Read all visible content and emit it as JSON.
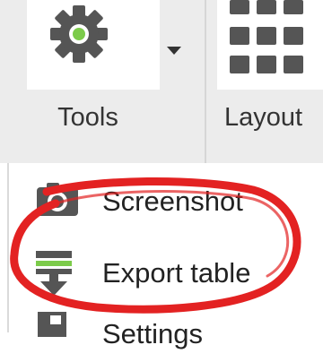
{
  "ribbon": {
    "tools": {
      "label": "Tools",
      "icon": "gear-icon",
      "accent": "#7ccb4a"
    },
    "layout": {
      "label": "Layout",
      "icon": "grid-icon"
    }
  },
  "menu": {
    "items": [
      {
        "label": "Screenshot",
        "icon": "camera-icon"
      },
      {
        "label": "Export table",
        "icon": "export-table-icon",
        "accent": "#7ccb4a"
      },
      {
        "label": "Settings",
        "icon": "settings-icon"
      }
    ]
  },
  "annotation": {
    "color": "#e32222"
  }
}
